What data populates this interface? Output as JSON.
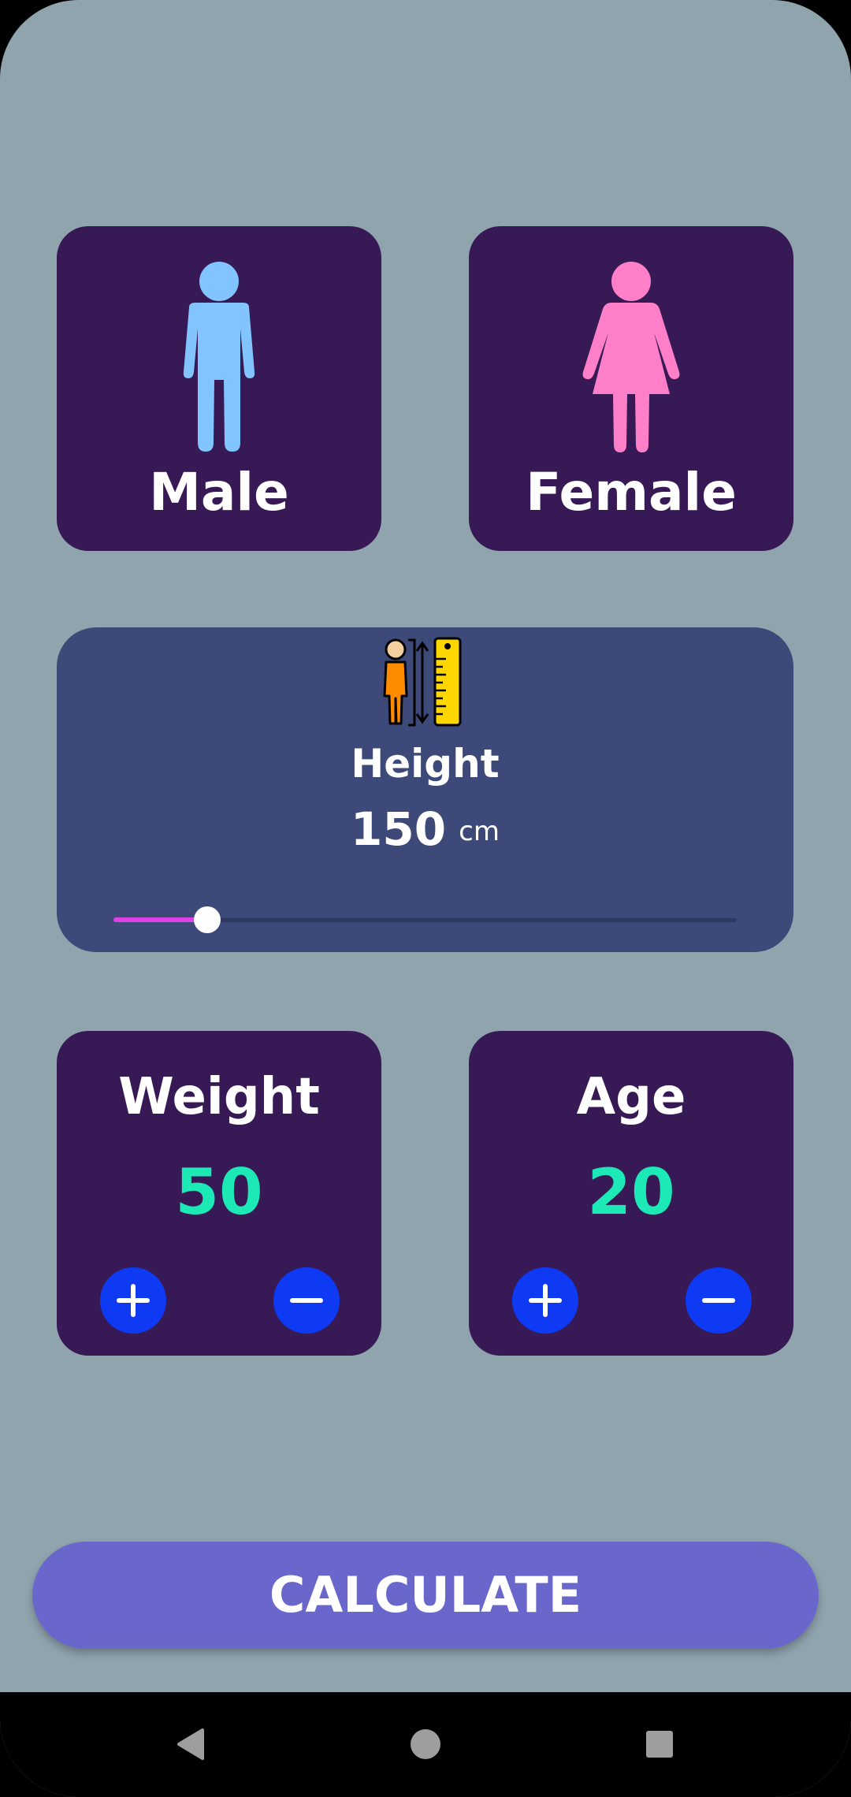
{
  "gender": {
    "male": {
      "label": "Male",
      "icon": "male-person-icon",
      "color": "#82c4ff"
    },
    "female": {
      "label": "Female",
      "icon": "female-person-icon",
      "color": "#ff7fc9"
    }
  },
  "height": {
    "icon": "height-measure-icon",
    "title": "Height",
    "value": "150",
    "unit": "cm",
    "slider_fraction": 0.15
  },
  "weight": {
    "title": "Weight",
    "value": "50",
    "plus_icon": "plus-icon",
    "minus_icon": "minus-icon"
  },
  "age": {
    "title": "Age",
    "value": "20",
    "plus_icon": "plus-icon",
    "minus_icon": "minus-icon"
  },
  "calculate": {
    "label": "CALCULATE"
  },
  "colors": {
    "background": "#90a4ae",
    "card": "#371a55",
    "height_card": "#3d4a79",
    "accent_value": "#1de9b6",
    "round_button": "#0d3af2",
    "calculate_button": "#6a67cc",
    "slider_active": "#e040e8"
  },
  "navbar": {
    "back_icon": "back-triangle-icon",
    "home_icon": "home-circle-icon",
    "recents_icon": "recents-square-icon"
  }
}
